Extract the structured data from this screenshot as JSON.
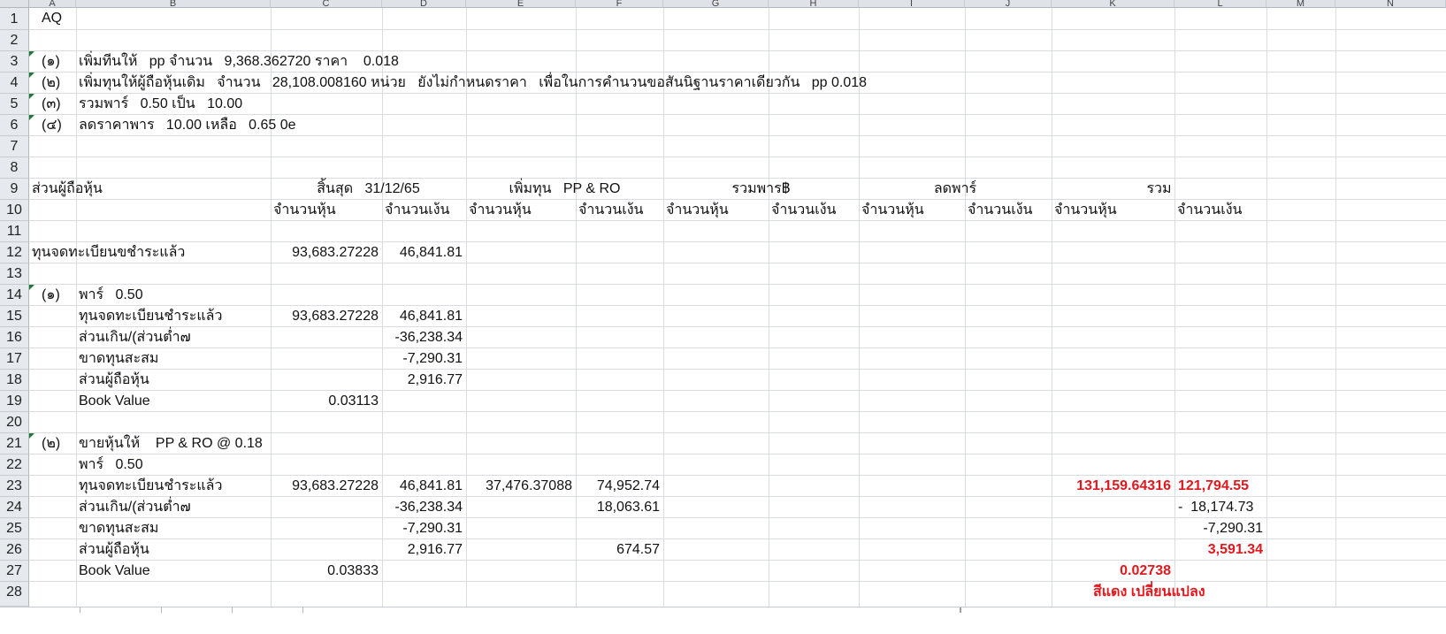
{
  "columns": [
    "A",
    "B",
    "C",
    "D",
    "E",
    "F",
    "G",
    "H",
    "I",
    "J",
    "K",
    "L",
    "M",
    "N"
  ],
  "rows": [
    "1",
    "2",
    "3",
    "4",
    "5",
    "6",
    "7",
    "8",
    "9",
    "10",
    "11",
    "12",
    "13",
    "14",
    "15",
    "16",
    "17",
    "18",
    "19",
    "20",
    "21",
    "22",
    "23",
    "24",
    "25",
    "26",
    "27",
    "28"
  ],
  "cells": {
    "a1": "AQ",
    "a3": "(๑)",
    "b3": "เพิ่มทีนให้   pp จำนวน   9,368.362720 ราคา    0.018",
    "a4": "(๒)",
    "b4": "เพิ่มทุนให้ผู้ถือหุ้นเดิม   จำนวน   28,108.008160 หน่วย   ยังไม่กำหนดราคา   เพื่อในการคำนวนขอสันนิฐานราคาเดียวกัน   pp 0.018",
    "a5": "(๓)",
    "b5": "รวมพาร์   0.50 เป็น   10.00",
    "a6": "(๔)",
    "b6": "ลดราคาพาร   10.00 เหลือ   0.65 0e",
    "a9": "ส่วนผู้ถือหุ้น",
    "cd9": "สิ้นสุด   31/12/65",
    "ef9": "เพิ่มทุน   PP & RO",
    "gh9": "รวมพาร฿",
    "ij9": "ลดพาร์",
    "kl9": "รวม",
    "c10": "จำนวนหุ้น",
    "d10": "จำนวนเง้น",
    "e10": "จำนวนหุ้น",
    "f10": "จำนวนเง้น",
    "g10": "จำนวนหุ้น",
    "h10": "จำนวนเง้น",
    "i10": "จำนวนหุ้น",
    "j10": "จำนวนเง้น",
    "k10": "จำนวนหุ้น",
    "l10": "จำนวนเง้น",
    "a12": "ทุนจดทะเบียนขชำระแล้ว",
    "c12": "93,683.27228",
    "d12": "46,841.81",
    "a14": "(๑)",
    "b14": "พาร์   0.50",
    "b15": "ทุนจดทะเบียนชำระแล้ว",
    "c15": "93,683.27228",
    "d15": "46,841.81",
    "b16": "ส่วนเกิน/(ส่วนต่ำ๗",
    "d16": "-36,238.34",
    "b17": "ขาดทุนสะสม",
    "d17": "-7,290.31",
    "b18": "ส่วนผู้ถือหุ้น",
    "d18": "2,916.77",
    "b19": "Book Value",
    "c19": "0.03113",
    "a21": "(๒)",
    "b21": "ขายหุ้นให้    PP & RO @ 0.18",
    "b22": "พาร์   0.50",
    "b23": "ทุนจดทะเบียนชำระแล้ว",
    "c23": "93,683.27228",
    "d23": "46,841.81",
    "e23": "37,476.37088",
    "f23": "74,952.74",
    "k23": "131,159.64316",
    "l23": "121,794.55",
    "b24": "ส่วนเกิน/(ส่วนต่ำ๗",
    "d24": "-36,238.34",
    "f24": "18,063.61",
    "l24": "-  18,174.73",
    "b25": "ขาดทุนสะสม",
    "d25": "-7,290.31",
    "l25": "-7,290.31",
    "b26": "ส่วนผู้ถือหุ้น",
    "d26": "2,916.77",
    "f26": "674.57",
    "l26": "3,591.34",
    "b27": "Book Value",
    "c27": "0.03833",
    "k27": "0.02738",
    "k28": "สีแดง เปลี่ยนแปลง"
  },
  "colors": {
    "red": "#e0191e",
    "grid": "#d9dde2",
    "header_bg": "#dfe3e8",
    "comment_marker": "#1f7a34"
  }
}
